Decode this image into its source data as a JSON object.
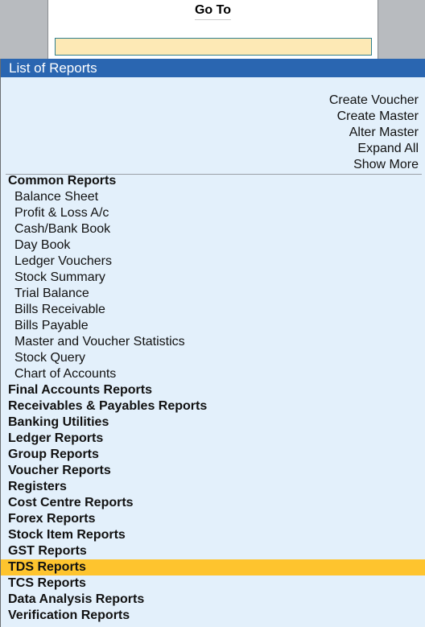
{
  "goto": {
    "title": "Go To",
    "input_value": "",
    "input_placeholder": ""
  },
  "list": {
    "title": "List of Reports",
    "actions": [
      {
        "label": "Create Voucher"
      },
      {
        "label": "Create Master"
      },
      {
        "label": "Alter Master"
      },
      {
        "label": "Expand All"
      },
      {
        "label": "Show More"
      }
    ],
    "items": [
      {
        "label": "Common Reports",
        "type": "group"
      },
      {
        "label": "Balance Sheet",
        "type": "sub"
      },
      {
        "label": "Profit & Loss A/c",
        "type": "sub"
      },
      {
        "label": "Cash/Bank Book",
        "type": "sub"
      },
      {
        "label": "Day Book",
        "type": "sub"
      },
      {
        "label": "Ledger Vouchers",
        "type": "sub"
      },
      {
        "label": "Stock Summary",
        "type": "sub"
      },
      {
        "label": "Trial Balance",
        "type": "sub"
      },
      {
        "label": "Bills Receivable",
        "type": "sub"
      },
      {
        "label": "Bills Payable",
        "type": "sub"
      },
      {
        "label": "Master and Voucher Statistics",
        "type": "sub"
      },
      {
        "label": "Stock Query",
        "type": "sub"
      },
      {
        "label": "Chart of Accounts",
        "type": "sub"
      },
      {
        "label": "Final Accounts Reports",
        "type": "group"
      },
      {
        "label": "Receivables & Payables Reports",
        "type": "group"
      },
      {
        "label": "Banking Utilities",
        "type": "group"
      },
      {
        "label": "Ledger Reports",
        "type": "group"
      },
      {
        "label": "Group Reports",
        "type": "group"
      },
      {
        "label": "Voucher Reports",
        "type": "group"
      },
      {
        "label": "Registers",
        "type": "group"
      },
      {
        "label": "Cost Centre Reports",
        "type": "group"
      },
      {
        "label": "Forex Reports",
        "type": "group"
      },
      {
        "label": "Stock Item Reports",
        "type": "group"
      },
      {
        "label": "GST Reports",
        "type": "group"
      },
      {
        "label": "TDS Reports",
        "type": "group",
        "selected": true
      },
      {
        "label": "TCS Reports",
        "type": "group"
      },
      {
        "label": "Data Analysis Reports",
        "type": "group"
      },
      {
        "label": "Verification Reports",
        "type": "group"
      }
    ]
  },
  "colors": {
    "header_bg": "#2a66b1",
    "list_bg": "#e3f0fb",
    "selected_bg": "#fec42e",
    "input_bg": "#fde9b5"
  }
}
